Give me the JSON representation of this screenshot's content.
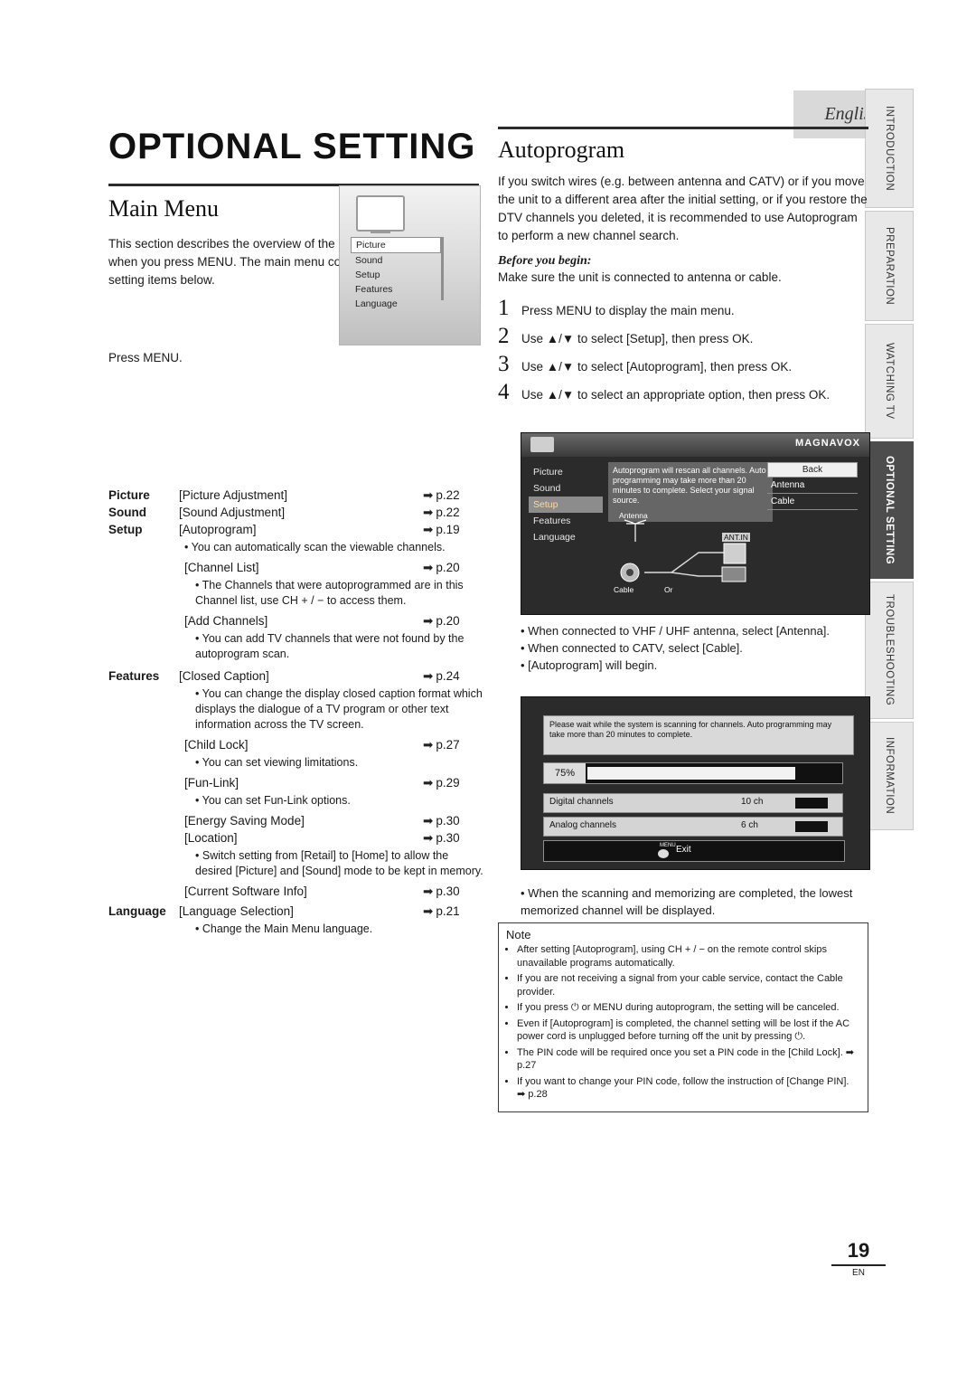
{
  "language_badge": "English",
  "side_tabs": [
    {
      "label": "INTRODUCTION",
      "active": false
    },
    {
      "label": "PREPARATION",
      "active": false
    },
    {
      "label": "WATCHING TV",
      "active": false
    },
    {
      "label": "OPTIONAL SETTING",
      "active": true
    },
    {
      "label": "TROUBLESHOOTING",
      "active": false
    },
    {
      "label": "INFORMATION",
      "active": false
    }
  ],
  "left": {
    "title": "OPTIONAL SETTING",
    "section_heading": "Main Menu",
    "intro": "This section describes the overview of the main menu displayed when you press MENU. The main menu consists of the function setting items below.",
    "press_menu": "Press MENU.",
    "tv_menu_items": [
      "Picture",
      "Sound",
      "Setup",
      "Features",
      "Language"
    ],
    "tv_menu_selected": "Picture",
    "menu_rows": [
      {
        "label": "Picture",
        "item": "[Picture Adjustment]",
        "page": "p.22"
      },
      {
        "label": "Sound",
        "item": "[Sound Adjustment]",
        "page": "p.22"
      },
      {
        "label": "Setup",
        "item": "[Autoprogram]",
        "page": "p.19"
      }
    ],
    "setup_bullet1": "You can automatically scan the viewable channels.",
    "channel_list": {
      "item": "[Channel List]",
      "page": "p.20"
    },
    "channel_list_bullet": "The Channels that were autoprogrammed are in this Channel list, use CH + / − to access them.",
    "add_channels": {
      "item": "[Add Channels]",
      "page": "p.20"
    },
    "add_channels_bullet": "You can add TV channels that were not found by the autoprogram scan.",
    "features_row": {
      "label": "Features",
      "item": "[Closed Caption]",
      "page": "p.24"
    },
    "closed_caption_bullet": "You can change the display closed caption format which displays the dialogue of a TV program or other text information across the TV screen.",
    "child_lock": {
      "item": "[Child Lock]",
      "page": "p.27"
    },
    "child_lock_bullet": "You can set viewing limitations.",
    "fun_link": {
      "item": "[Fun-Link]",
      "page": "p.29"
    },
    "fun_link_bullet": "You can set Fun-Link options.",
    "energy": {
      "item": "[Energy Saving Mode]",
      "page": "p.30"
    },
    "location": {
      "item": "[Location]",
      "page": "p.30"
    },
    "location_bullet": "Switch setting from [Retail] to [Home] to allow the desired [Picture] and [Sound] mode to be kept in memory.",
    "current_sw": {
      "item": "[Current Software Info]",
      "page": "p.30"
    },
    "language_row": {
      "label": "Language",
      "item": "[Language Selection]",
      "page": "p.21"
    },
    "language_bullet": "Change the Main Menu language."
  },
  "right": {
    "heading": "Autoprogram",
    "intro": "If you switch wires (e.g. between antenna and CATV) or if you move the unit to a different area after the initial setting, or if you restore the DTV channels you deleted, it is recommended to use Autoprogram to perform a new channel search.",
    "before_you_begin": "Before you begin:",
    "before_text": "Make sure the unit is connected to antenna or cable.",
    "steps": [
      {
        "n": "1",
        "text": "Press MENU to display the main menu."
      },
      {
        "n": "2",
        "text": "Use ▲/▼ to select [Setup], then press OK."
      },
      {
        "n": "3",
        "text": "Use ▲/▼ to select [Autoprogram], then press OK."
      },
      {
        "n": "4",
        "text": "Use ▲/▼ to select an appropriate option, then press OK."
      }
    ],
    "shot1": {
      "brand": "MAGNAVOX",
      "menu_items": [
        "Picture",
        "Sound",
        "Setup",
        "Features",
        "Language"
      ],
      "menu_selected": "Setup",
      "info_text": "Autoprogram will rescan all channels. Auto programming may take more than 20 minutes to complete. Select your signal source.",
      "back_label": "Back",
      "options": [
        "Antenna",
        "Cable"
      ],
      "diagram_labels": [
        "Antenna",
        "Cable",
        "Or",
        "ANT.IN"
      ]
    },
    "shot1_bullets": [
      "When connected to VHF / UHF antenna, select [Antenna].",
      "When connected to CATV, select [Cable].",
      "[Autoprogram] will begin."
    ],
    "shot2": {
      "message": "Please wait while the system is scanning for channels. Auto programming may take more than 20 minutes to complete.",
      "percent": "75%",
      "rows": [
        {
          "label": "Digital channels",
          "value": "10 ch"
        },
        {
          "label": "Analog channels",
          "value": "6 ch"
        }
      ],
      "exit_label": "Exit",
      "exit_icon": "MENU"
    },
    "shot2_bullet": "When the scanning and memorizing are completed, the lowest memorized channel will be displayed.",
    "note": {
      "title": "Note",
      "items": [
        "After setting [Autoprogram], using CH + / − on the remote control skips unavailable programs automatically.",
        "If you are not receiving a signal from your cable service, contact the Cable provider.",
        "If you press ⏻ or MENU during autoprogram, the setting will be canceled.",
        "Even if [Autoprogram] is completed, the channel setting will be lost if the AC power cord is unplugged before turning off the unit by pressing ⏻.",
        "The PIN code will be required once you set a PIN code in the [Child Lock]. ➡ p.27",
        "If you want to change your PIN code, follow the instruction of [Change PIN]. ➡ p.28"
      ]
    }
  },
  "footer": {
    "page_number": "19",
    "lang_code": "EN"
  }
}
